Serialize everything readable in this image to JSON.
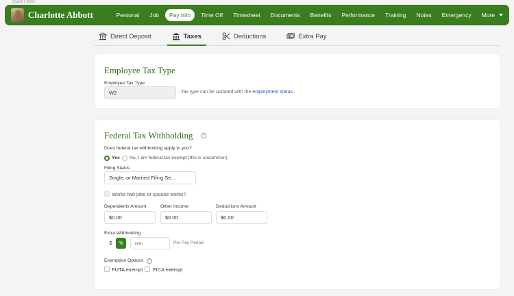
{
  "faint_top_text": "Quick Filters",
  "employee": {
    "name": "Charlotte Abbott"
  },
  "nav": {
    "items": [
      "Personal",
      "Job",
      "Pay Info",
      "Time Off",
      "Timesheet",
      "Documents",
      "Benefits",
      "Performance",
      "Training",
      "Notes",
      "Emergency"
    ],
    "active": "Pay Info",
    "more_label": "More"
  },
  "subtabs": [
    {
      "label": "Direct Deposit",
      "icon": "bank-icon"
    },
    {
      "label": "Taxes",
      "icon": "government-icon",
      "active": true
    },
    {
      "label": "Deductions",
      "icon": "scissors-icon"
    },
    {
      "label": "Extra Pay",
      "icon": "money-stack-icon"
    }
  ],
  "tax_type": {
    "title": "Employee Tax Type",
    "field_label": "Employee Tax Type",
    "value": "W2",
    "note_prefix": "Tax type can be updated with the",
    "note_link": "employment status",
    "note_suffix": "."
  },
  "federal": {
    "title": "Federal Tax Withholding",
    "question": "Does federal tax withholding apply to you?",
    "yes_label": "Yes",
    "no_label": "No, I am federal tax exempt (this is uncommon)",
    "filing_status_label": "Filing Status",
    "filing_status_value": "Single, or Married Filing Se...",
    "two_jobs_label": "Works two jobs or spouse works?",
    "dependents_label": "Dependents Amount",
    "dependents_value": "$0.00",
    "other_income_label": "Other Income",
    "other_income_value": "$0.00",
    "deductions_label": "Deductions Amount",
    "deductions_value": "$0.00",
    "extra_label": "Extra Withholding",
    "dollar_symbol": "$",
    "percent_symbol": "%",
    "extra_value": "0%",
    "per_period": "Per Pay Period",
    "exemption_label": "Exemption Options",
    "futa_label": "FUTA exempt",
    "fica_label": "FICA exempt"
  },
  "colors": {
    "brand_green": "#3a7d1e",
    "link_blue": "#2259b5",
    "page_bg": "#f4f4f4"
  }
}
